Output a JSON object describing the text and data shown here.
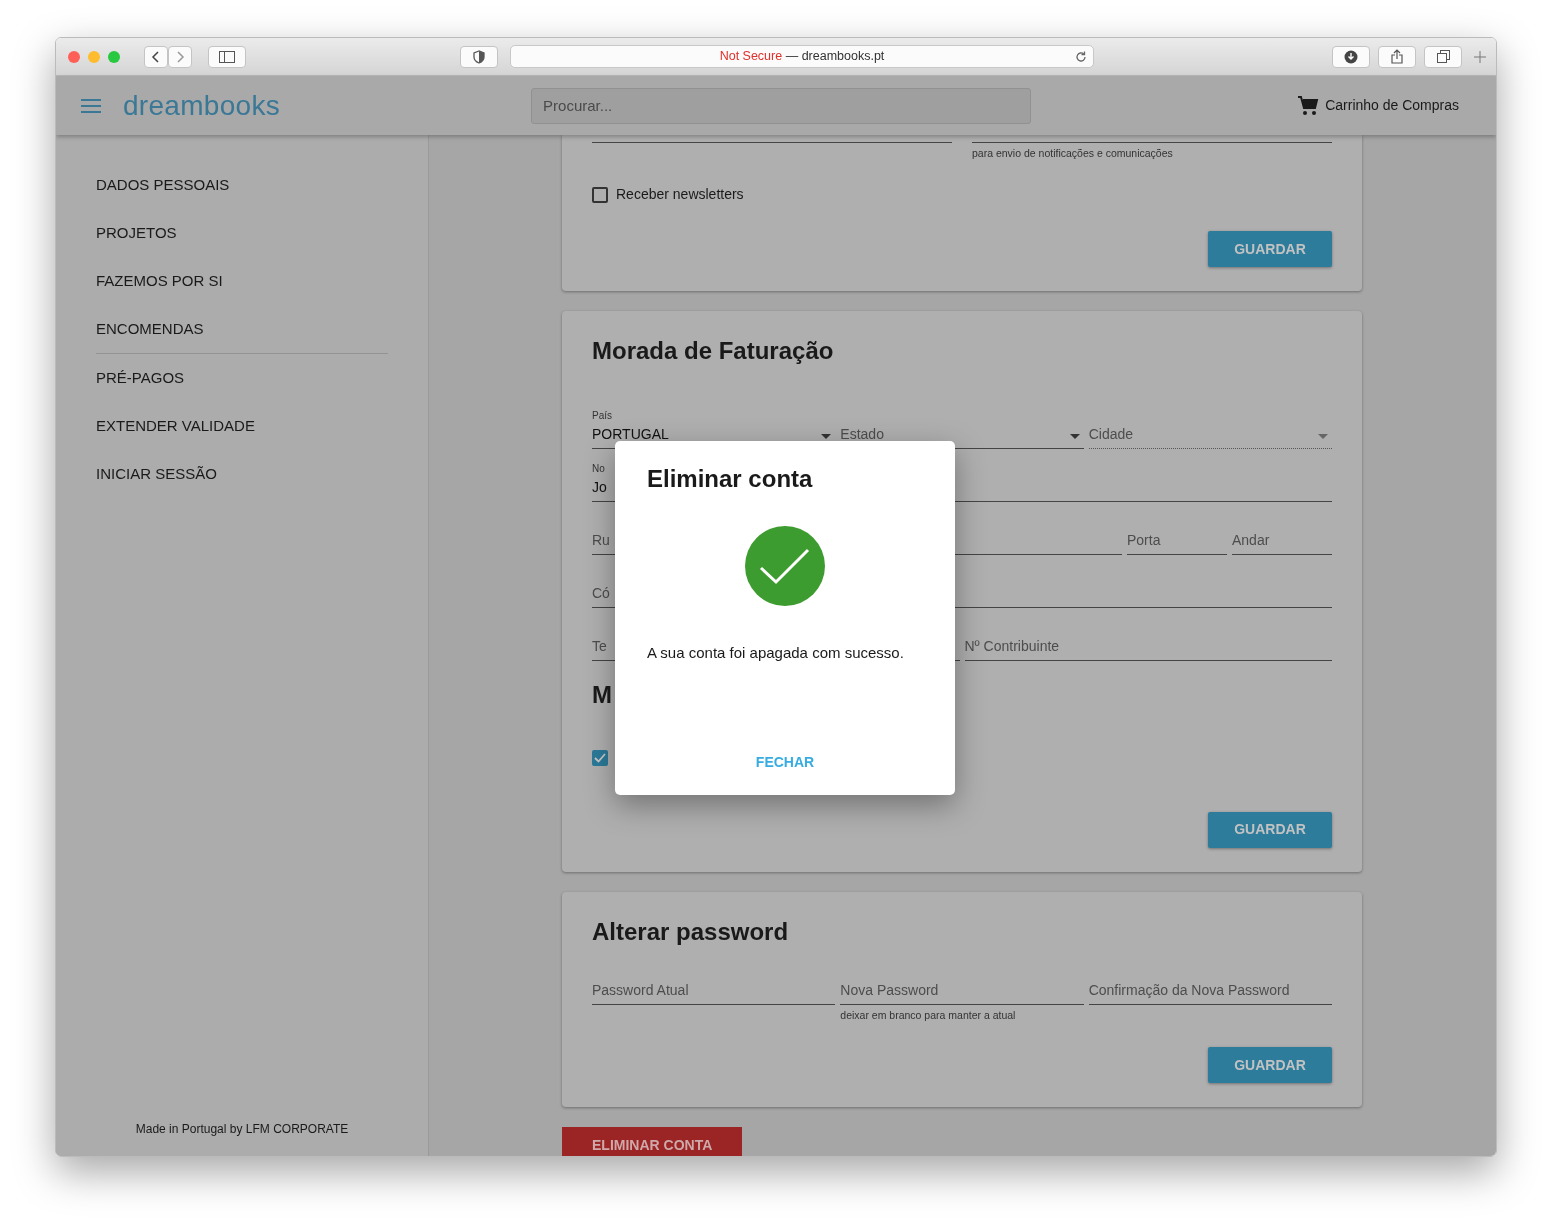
{
  "browser": {
    "security": "Not Secure",
    "address": "— dreambooks.pt"
  },
  "header": {
    "logo": "dreambooks",
    "search_placeholder": "Procurar...",
    "cart": "Carrinho de Compras"
  },
  "sidebar": {
    "groups": [
      [
        {
          "label": "DADOS PESSOAIS"
        },
        {
          "label": "PROJETOS"
        },
        {
          "label": "FAZEMOS POR SI"
        },
        {
          "label": "ENCOMENDAS"
        }
      ],
      [
        {
          "label": "PRÉ-PAGOS"
        },
        {
          "label": "EXTENDER VALIDADE"
        },
        {
          "label": "INICIAR SESSÃO"
        }
      ]
    ],
    "footer": "Made in Portugal by LFM CORPORATE"
  },
  "cards": [
    {
      "kind": "partial",
      "rows": [
        [
          {
            "kind": "text",
            "disabled": false
          },
          {
            "kind": "text",
            "disabled": false,
            "helper": "para envio de notificações e comunicações"
          }
        ]
      ],
      "checkbox": {
        "label": "Receber newsletters",
        "checked": false
      },
      "button": "GUARDAR"
    },
    {
      "kind": "full",
      "title": "Morada de Faturação",
      "rows": [
        [
          {
            "kind": "select",
            "disabled": false,
            "label": "País",
            "value": "PORTUGAL"
          },
          {
            "kind": "select",
            "disabled": false,
            "placeholder": "Estado"
          },
          {
            "kind": "select",
            "disabled": true,
            "placeholder": "Cidade"
          }
        ],
        [
          {
            "kind": "text",
            "disabled": false,
            "label": "No",
            "value": "Jo"
          }
        ],
        [
          {
            "kind": "text",
            "disabled": false,
            "placeholder": "Ru"
          },
          {
            "kind": "narrow",
            "disabled": false,
            "placeholder": "Porta"
          },
          {
            "kind": "narrow",
            "disabled": false,
            "placeholder": "Andar"
          }
        ],
        [
          {
            "kind": "text",
            "disabled": false,
            "placeholder": "Có"
          }
        ],
        [
          {
            "kind": "text",
            "disabled": false,
            "placeholder": "Te"
          },
          {
            "kind": "text",
            "disabled": false,
            "placeholder": "Nº Contribuinte"
          }
        ]
      ],
      "subtitle": "M",
      "checkbox": {
        "checked": true
      },
      "button": "GUARDAR"
    },
    {
      "kind": "full",
      "title": "Alterar password",
      "rows": [
        [
          {
            "kind": "text",
            "disabled": false,
            "placeholder": "Password Atual"
          },
          {
            "kind": "text",
            "disabled": false,
            "placeholder": "Nova Password",
            "helper": "deixar em branco para manter a atual"
          },
          {
            "kind": "text",
            "disabled": false,
            "placeholder": "Confirmação da Nova Password"
          }
        ]
      ],
      "button": "GUARDAR"
    }
  ],
  "danger_button": "ELIMINAR CONTA",
  "modal": {
    "title": "Eliminar conta",
    "message": "A sua conta foi apagada com sucesso.",
    "button": "FECHAR"
  }
}
